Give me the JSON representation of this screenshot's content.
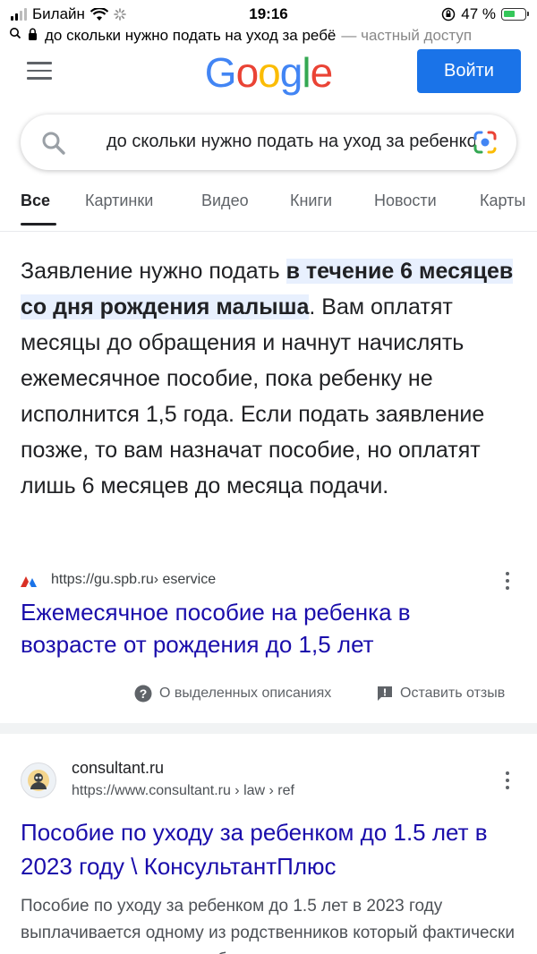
{
  "status_bar": {
    "carrier": "Билайн",
    "time": "19:16",
    "battery_percent": "47 %"
  },
  "url_bar": {
    "url_text": "до скольки нужно подать на уход за ребё",
    "privacy_label": "— частный доступ"
  },
  "header": {
    "logo_letters": [
      "G",
      "o",
      "o",
      "g",
      "l",
      "e"
    ],
    "logo_colors": [
      "#4285F4",
      "#EA4335",
      "#FBBC05",
      "#4285F4",
      "#34A853",
      "#EA4335"
    ],
    "signin_label": "Войти"
  },
  "search": {
    "query": "до скольки нужно подать на уход за ребенком"
  },
  "tabs": [
    "Все",
    "Картинки",
    "Видео",
    "Книги",
    "Новости",
    "Карты"
  ],
  "snippet": {
    "lead": "Заявление нужно подать ",
    "highlight": "в течение 6 месяцев со дня рождения малыша",
    "rest": ". Вам оплатят месяцы до обращения и начнут начислять ежемесячное пособие, пока ребенку не исполнится 1,5 года. Если подать заявление позже, то вам назначат пособие, но оплатят лишь 6 месяцев до месяца подачи.",
    "source_url": "https://gu.spb.ru",
    "source_path": " › eservice",
    "link_title": "Ежемесячное пособие на ребенка в возрасте от рождения до 1,5 лет",
    "about_label": "О выделенных описаниях",
    "feedback_label": "Оставить отзыв"
  },
  "result2": {
    "site_name": "consultant.ru",
    "url": "https://www.consultant.ru",
    "path": " › law › ref",
    "title": "Пособие по уходу за ребенком до 1.5 лет в 2023 году \\ КонсультантПлюс",
    "description": "Пособие по уходу за ребенком до 1.5 лет в 2023 году выплачивается одному из родственников который фактически осуществляет уход за ребенком"
  }
}
